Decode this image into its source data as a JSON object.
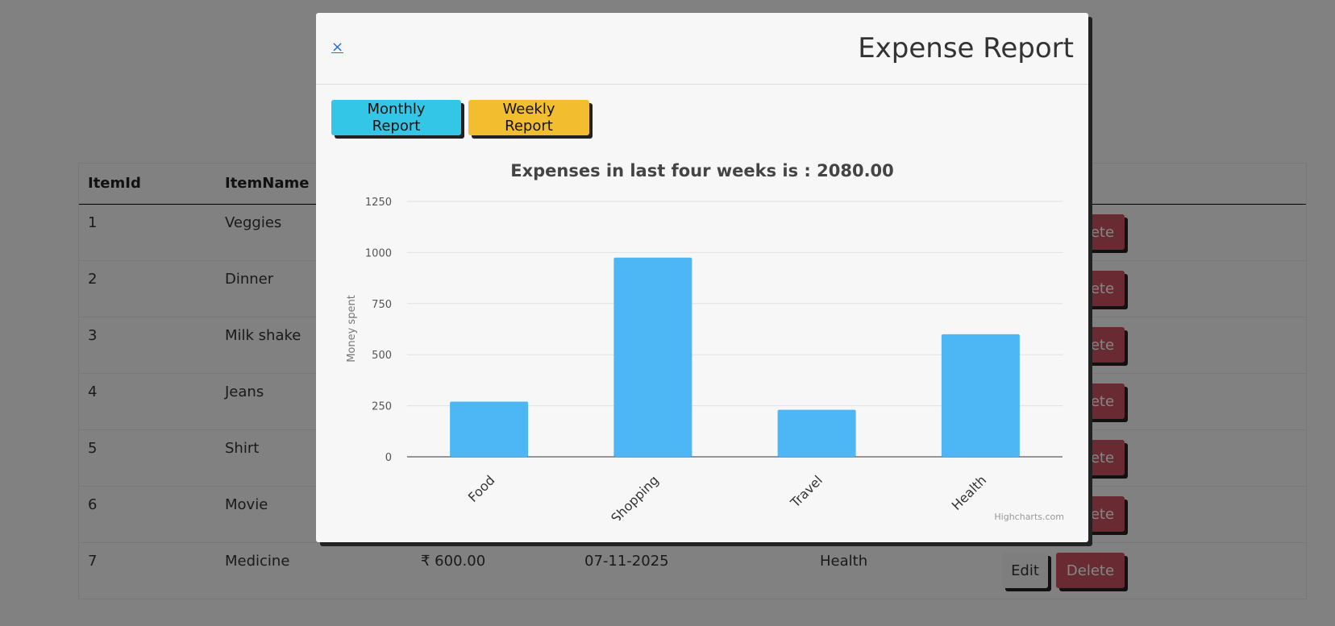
{
  "table": {
    "headers": [
      "ItemId",
      "ItemName"
    ],
    "rows": [
      {
        "id": "1",
        "name": "Veggies"
      },
      {
        "id": "2",
        "name": "Dinner"
      },
      {
        "id": "3",
        "name": "Milk shake"
      },
      {
        "id": "4",
        "name": "Jeans"
      },
      {
        "id": "5",
        "name": "Shirt"
      },
      {
        "id": "6",
        "name": "Movie"
      },
      {
        "id": "7",
        "name": "Medicine",
        "amount": "₹ 600.00",
        "date": "07-11-2025",
        "category": "Health"
      }
    ],
    "edit_label": "Edit",
    "delete_label": "Delete"
  },
  "modal": {
    "close_label": "×",
    "title": "Expense Report",
    "monthly_label": "Monthly Report",
    "weekly_label": "Weekly Report",
    "credit": "Highcharts.com"
  },
  "colors": {
    "bar": "#4db6f5",
    "monthly_button": "#34c6e6",
    "weekly_button": "#f2be2f",
    "delete_button": "#c9535e"
  },
  "chart_data": {
    "type": "bar",
    "title": "Expenses in last four weeks is : 2080.00",
    "ylabel": "Money spent",
    "xlabel": "",
    "categories": [
      "Food",
      "Shopping",
      "Travel",
      "Health"
    ],
    "values": [
      270,
      975,
      230,
      600
    ],
    "ylim": [
      0,
      1250
    ],
    "yticks": [
      "0",
      "250",
      "500",
      "750",
      "1000",
      "1250"
    ],
    "grid": true,
    "legend": "none"
  }
}
